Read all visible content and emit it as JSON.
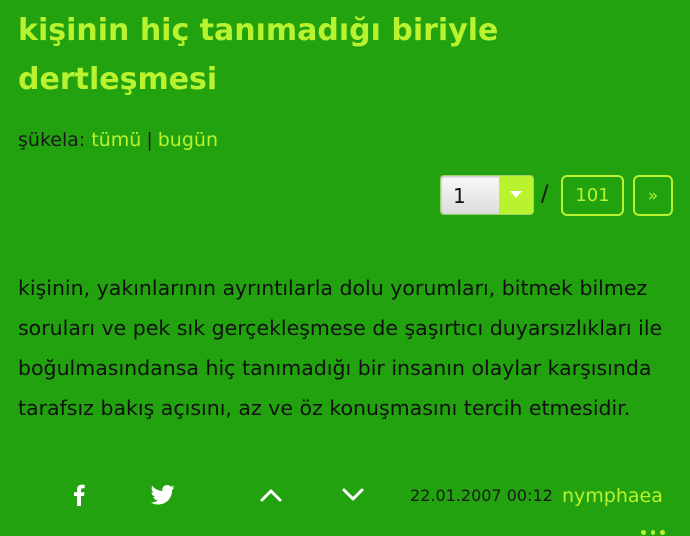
{
  "topic": {
    "title": "kişinin hiç tanımadığı biriyle dertleşmesi"
  },
  "sukela": {
    "label": "şükela:",
    "all": "tümü",
    "separator": "|",
    "today": "bugün"
  },
  "pager": {
    "current_page": "1",
    "separator": "/",
    "total_pages": "101",
    "next_label": "»"
  },
  "entry": {
    "text": "kişinin, yakınlarının ayrıntılarla dolu yorumları, bitmek bilmez soruları ve pek sık gerçekleşmese de şaşırtıcı duyarsızlıkları ile boğulmasındansa hiç tanımadığı bir insanın olaylar karşısında tarafsız bakış açısını, az ve öz konuşmasını tercih etmesidir.",
    "date": "22.01.2007 00:12",
    "author": "nymphaea"
  },
  "icons": {
    "share_facebook": "facebook-icon",
    "share_twitter": "twitter-icon",
    "upvote": "chevron-up-icon",
    "downvote": "chevron-down-icon",
    "more": "more-dots-icon",
    "dropdown": "dropdown-arrow-icon"
  },
  "colors": {
    "background": "#22a20e",
    "accent": "#b9f32f",
    "text": "#111111"
  }
}
